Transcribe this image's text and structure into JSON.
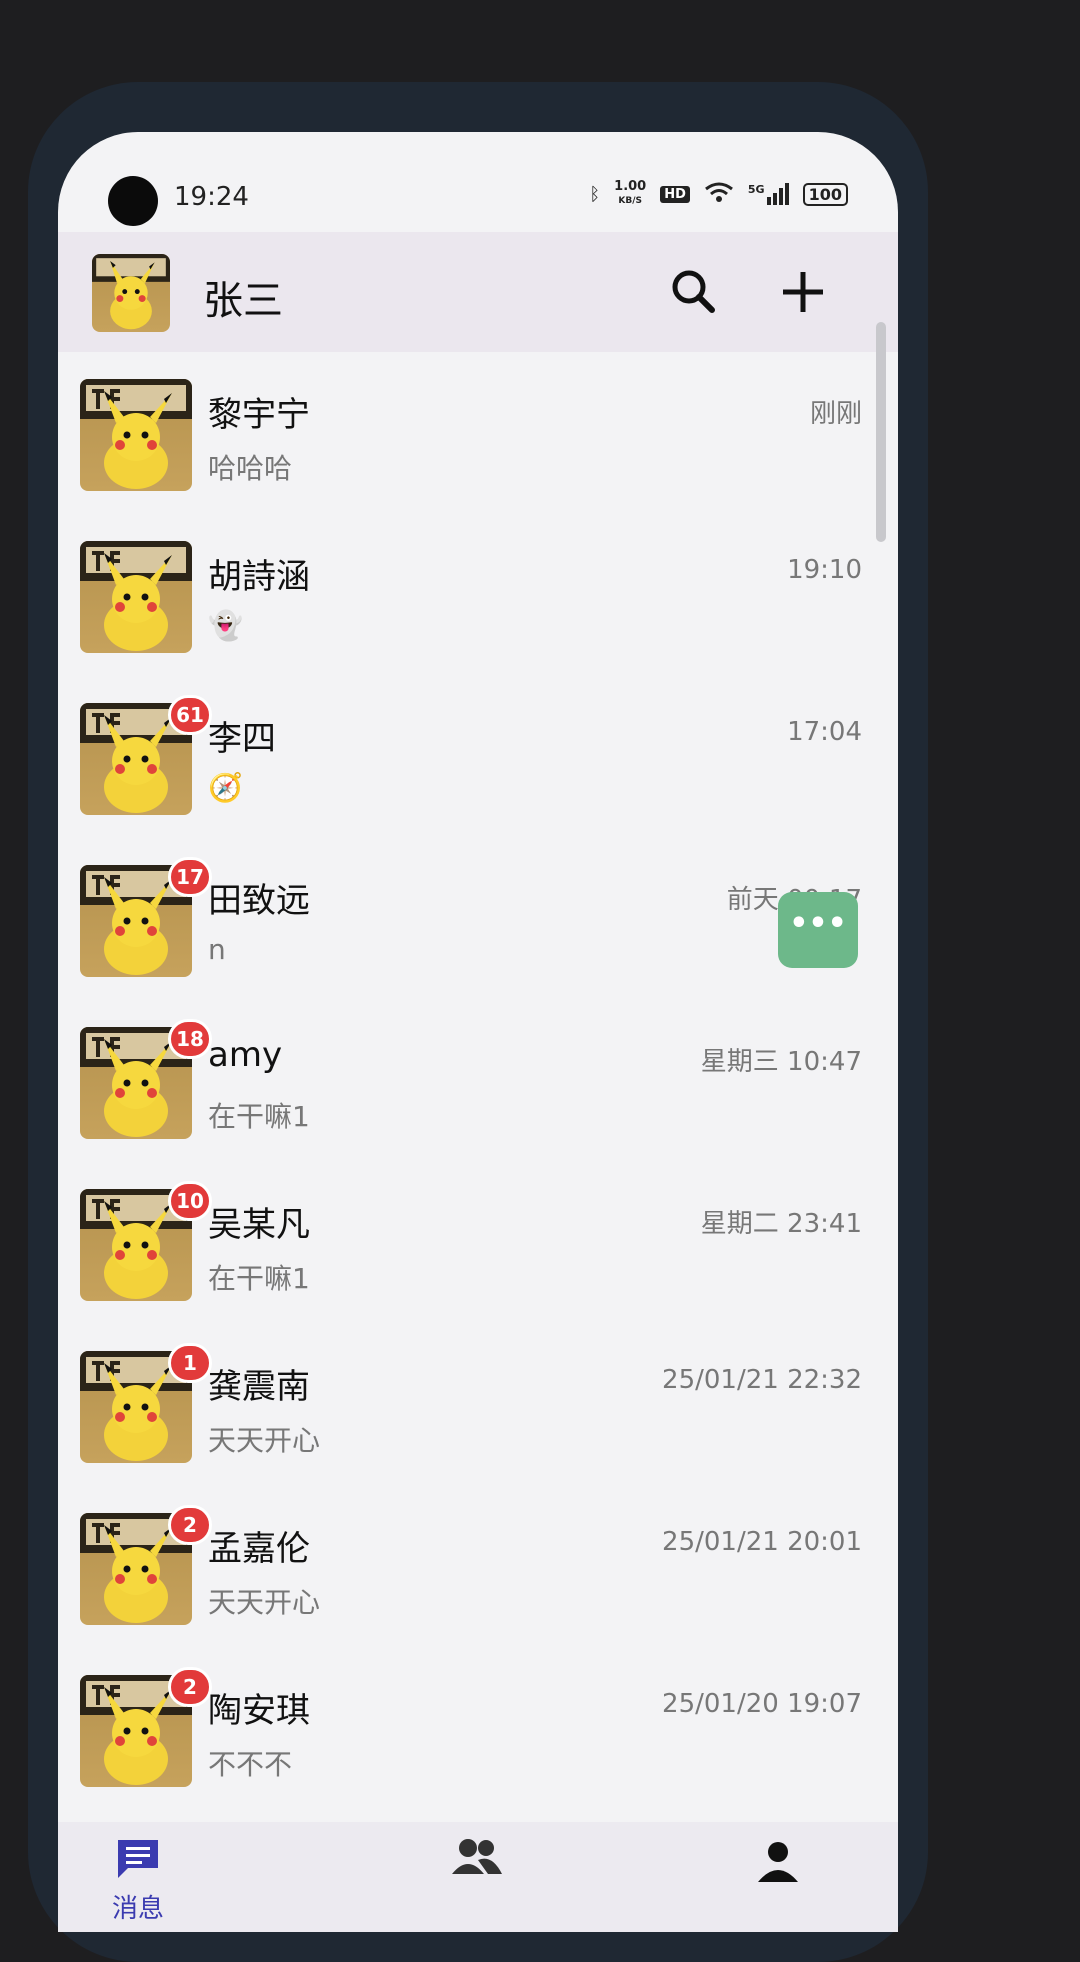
{
  "status_bar": {
    "time": "19:24",
    "speed_value": "1.00",
    "speed_unit": "KB/S",
    "hd": "HD",
    "network": "5G",
    "battery": "100"
  },
  "header": {
    "user_name": "张三"
  },
  "conversations": [
    {
      "name": "黎宇宁",
      "preview": "哈哈哈",
      "time": "刚刚",
      "badge": ""
    },
    {
      "name": "胡詩涵",
      "preview": "👻",
      "time": "19:10",
      "badge": ""
    },
    {
      "name": "李四",
      "preview": "🧭",
      "time": "17:04",
      "badge": "61"
    },
    {
      "name": "田致远",
      "preview": "n",
      "time": "前天 00:17",
      "badge": "17"
    },
    {
      "name": "amy",
      "preview": "在干嘛1",
      "time": "星期三 10:47",
      "badge": "18"
    },
    {
      "name": "吴某凡",
      "preview": "在干嘛1",
      "time": "星期二 23:41",
      "badge": "10"
    },
    {
      "name": "龚震南",
      "preview": "天天开心",
      "time": "25/01/21 22:32",
      "badge": "1"
    },
    {
      "name": "孟嘉伦",
      "preview": "天天开心",
      "time": "25/01/21 20:01",
      "badge": "2"
    },
    {
      "name": "陶安琪",
      "preview": "不不不",
      "time": "25/01/20 19:07",
      "badge": "2"
    }
  ],
  "floating_button": {
    "label": "•••"
  },
  "bottom_nav": {
    "messages": "消息"
  },
  "colors": {
    "accent": "#3b3bb0",
    "badge": "#e23a3a",
    "float": "#6db88a"
  }
}
